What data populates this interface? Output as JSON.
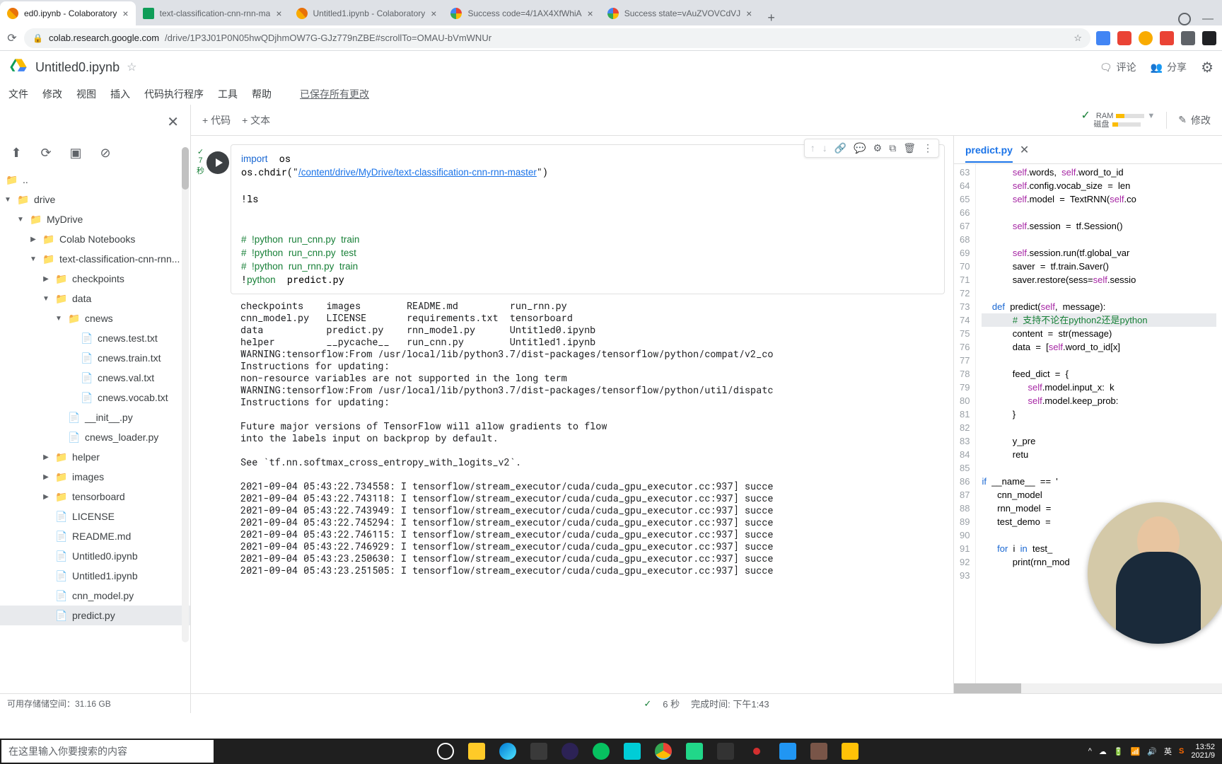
{
  "browser": {
    "tabs": [
      {
        "title": "ed0.ipynb - Colaboratory",
        "icon": "colab",
        "active": true
      },
      {
        "title": "text-classification-cnn-rnn-ma",
        "icon": "drive",
        "active": false
      },
      {
        "title": "Untitled1.ipynb - Colaboratory",
        "icon": "colab",
        "active": false
      },
      {
        "title": "Success code=4/1AX4XfWhiA",
        "icon": "google",
        "active": false
      },
      {
        "title": "Success state=vAuZVOVCdVJ",
        "icon": "google",
        "active": false
      }
    ],
    "url_domain": "colab.research.google.com",
    "url_path": "/drive/1P3J01P0N05hwQDjhmOW7G-GJz779nZBE#scrollTo=OMAU-bVmWNUr"
  },
  "doc": {
    "title": "Untitled0.ipynb",
    "menus": [
      "文件",
      "修改",
      "视图",
      "插入",
      "代码执行程序",
      "工具",
      "帮助"
    ],
    "save_state": "已保存所有更改",
    "header_actions": {
      "comment": "评论",
      "share": "分享"
    }
  },
  "toolbar": {
    "add_code": "+ 代码",
    "add_text": "+ 文本",
    "ram": "RAM",
    "disk": "磁盘",
    "edit": "修改"
  },
  "sidebar": {
    "up": "..",
    "root": "drive",
    "tree": [
      {
        "d": 1,
        "t": "folder",
        "open": true,
        "name": "MyDrive"
      },
      {
        "d": 2,
        "t": "folder",
        "open": false,
        "name": "Colab Notebooks"
      },
      {
        "d": 2,
        "t": "folder",
        "open": true,
        "name": "text-classification-cnn-rnn..."
      },
      {
        "d": 3,
        "t": "folder",
        "open": false,
        "name": "checkpoints"
      },
      {
        "d": 3,
        "t": "folder",
        "open": true,
        "name": "data"
      },
      {
        "d": 4,
        "t": "folder",
        "open": true,
        "name": "cnews"
      },
      {
        "d": 5,
        "t": "file",
        "name": "cnews.test.txt"
      },
      {
        "d": 5,
        "t": "file",
        "name": "cnews.train.txt"
      },
      {
        "d": 5,
        "t": "file",
        "name": "cnews.val.txt"
      },
      {
        "d": 5,
        "t": "file",
        "name": "cnews.vocab.txt"
      },
      {
        "d": 4,
        "t": "file",
        "name": "__init__.py"
      },
      {
        "d": 4,
        "t": "file",
        "name": "cnews_loader.py"
      },
      {
        "d": 3,
        "t": "folder",
        "open": false,
        "name": "helper"
      },
      {
        "d": 3,
        "t": "folder",
        "open": false,
        "name": "images"
      },
      {
        "d": 3,
        "t": "folder",
        "open": false,
        "name": "tensorboard"
      },
      {
        "d": 3,
        "t": "file",
        "name": "LICENSE"
      },
      {
        "d": 3,
        "t": "file",
        "name": "README.md"
      },
      {
        "d": 3,
        "t": "file",
        "name": "Untitled0.ipynb"
      },
      {
        "d": 3,
        "t": "file",
        "name": "Untitled1.ipynb"
      },
      {
        "d": 3,
        "t": "file",
        "name": "cnn_model.py"
      },
      {
        "d": 3,
        "t": "file",
        "name": "predict.py",
        "sel": true
      }
    ],
    "storage": "可用存储储空间：31.16 GB"
  },
  "cell": {
    "gutter": {
      "check": "✓",
      "sec": "7",
      "unit": "秒"
    },
    "code": "import  os\nos.chdir(\"/content/drive/MyDrive/text-classification-cnn-rnn-master\")\n\n!ls\n\n\n#  !python  run_cnn.py  train\n#  !python  run_cnn.py  test\n#  !python  run_rnn.py  train\n!python  predict.py",
    "output": "checkpoints    images        README.md         run_rnn.py\ncnn_model.py   LICENSE       requirements.txt  tensorboard\ndata           predict.py    rnn_model.py      Untitled0.ipynb\nhelper         __pycache__   run_cnn.py        Untitled1.ipynb\nWARNING:tensorflow:From /usr/local/lib/python3.7/dist-packages/tensorflow/python/compat/v2_co\nInstructions for updating:\nnon-resource variables are not supported in the long term\nWARNING:tensorflow:From /usr/local/lib/python3.7/dist-packages/tensorflow/python/util/dispatc\nInstructions for updating:\n\nFuture major versions of TensorFlow will allow gradients to flow\ninto the labels input on backprop by default.\n\nSee `tf.nn.softmax_cross_entropy_with_logits_v2`.\n\n2021-09-04 05:43:22.734558: I tensorflow/stream_executor/cuda/cuda_gpu_executor.cc:937] succe\n2021-09-04 05:43:22.743118: I tensorflow/stream_executor/cuda/cuda_gpu_executor.cc:937] succe\n2021-09-04 05:43:22.743949: I tensorflow/stream_executor/cuda/cuda_gpu_executor.cc:937] succe\n2021-09-04 05:43:22.745294: I tensorflow/stream_executor/cuda/cuda_gpu_executor.cc:937] succe\n2021-09-04 05:43:22.746115: I tensorflow/stream_executor/cuda/cuda_gpu_executor.cc:937] succe\n2021-09-04 05:43:22.746929: I tensorflow/stream_executor/cuda/cuda_gpu_executor.cc:937] succe\n2021-09-04 05:43:23.250630: I tensorflow/stream_executor/cuda/cuda_gpu_executor.cc:937] succe\n2021-09-04 05:43:23.251505: I tensorflow/stream_executor/cuda/cuda_gpu_executor.cc:937] succe"
  },
  "right_panel": {
    "tab": "predict.py",
    "line_start": 63,
    "lines": [
      "            self.words,  self.word_to_id",
      "            self.config.vocab_size  =  len",
      "            self.model  =  TextRNN(self.co",
      "",
      "            self.session  =  tf.Session()",
      "",
      "            self.session.run(tf.global_var",
      "            saver  =  tf.train.Saver()",
      "            saver.restore(sess=self.sessio",
      "",
      "    def  predict(self,  message):",
      "            #  支持不论在python2还是python",
      "            content  =  str(message)",
      "            data  =  [self.word_to_id[x]  ",
      "",
      "            feed_dict  =  {",
      "                  self.model.input_x:  k",
      "                  self.model.keep_prob:",
      "            }",
      "",
      "            y_pre",
      "            retu",
      "",
      "if  __name__  ==  '",
      "      cnn_model  ",
      "      rnn_model  =",
      "      test_demo  =",
      "",
      "      for  i  in  test_",
      "            print(rnn_mod",
      ""
    ],
    "hl_line": 74
  },
  "status": {
    "check": "✓",
    "sec": "6 秒",
    "done": "完成时间: 下午1:43"
  },
  "taskbar": {
    "search_placeholder": "在这里输入你要搜索的内容",
    "time": "13:52",
    "date": "2021/9",
    "ime": "英"
  }
}
